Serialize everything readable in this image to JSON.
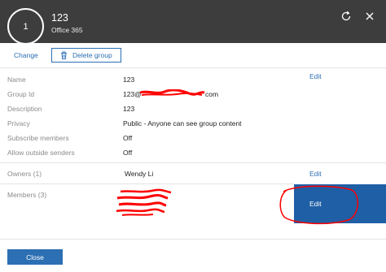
{
  "header": {
    "avatar_text": "1",
    "title": "123",
    "subtitle": "Office 365"
  },
  "actions": {
    "change_label": "Change",
    "delete_group_label": "Delete group"
  },
  "details": {
    "name_label": "Name",
    "name_value": "123",
    "name_edit": "Edit",
    "group_id_label": "Group Id",
    "group_id_prefix": "123@",
    "group_id_suffix": "com",
    "description_label": "Description",
    "description_value": "123",
    "privacy_label": "Privacy",
    "privacy_value": "Public - Anyone can see group content",
    "subscribe_label": "Subscribe members",
    "subscribe_value": "Off",
    "outside_label": "Allow outside senders",
    "outside_value": "Off"
  },
  "owners": {
    "label": "Owners (1)",
    "value": "Wendy Li",
    "edit": "Edit"
  },
  "members": {
    "label": "Members (3)",
    "edit": "Edit"
  },
  "footer": {
    "close_label": "Close"
  },
  "colors": {
    "header_bg": "#3d3d3d",
    "accent": "#2c6fb3",
    "highlight": "#1f5fa6",
    "redaction": "#ff0000"
  }
}
